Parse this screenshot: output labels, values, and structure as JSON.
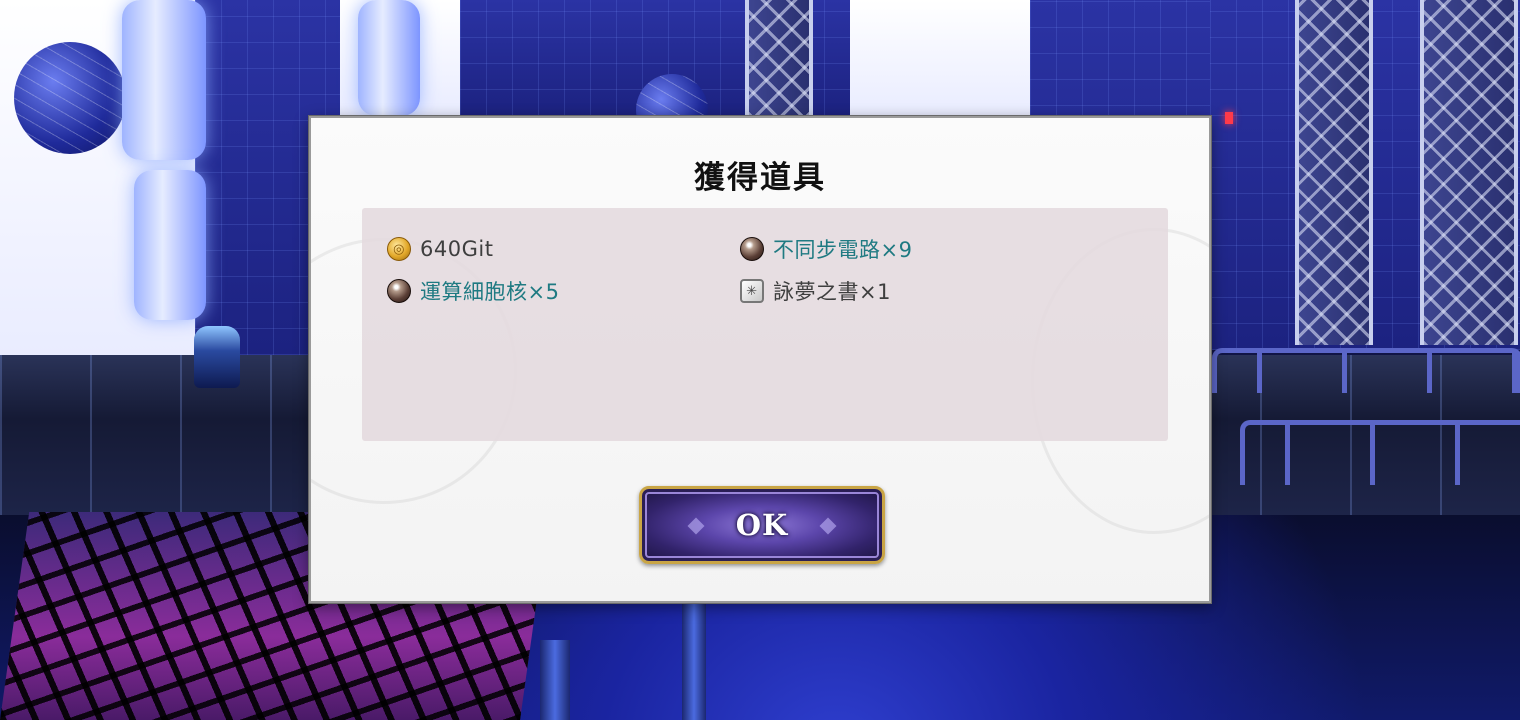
{
  "dialog": {
    "title": "獲得道具",
    "items": [
      {
        "icon": "gold-coin-icon",
        "label": "640Git",
        "color": "#3e3e3e"
      },
      {
        "icon": "dark-sphere-icon",
        "label": "不同步電路×9",
        "color": "#1f7a82"
      },
      {
        "icon": "dark-sphere-icon",
        "label": "運算細胞核×5",
        "color": "#1f7a82"
      },
      {
        "icon": "book-icon",
        "label": "詠夢之書×1",
        "color": "#3e3e3e"
      }
    ],
    "ok_label": "OK"
  }
}
